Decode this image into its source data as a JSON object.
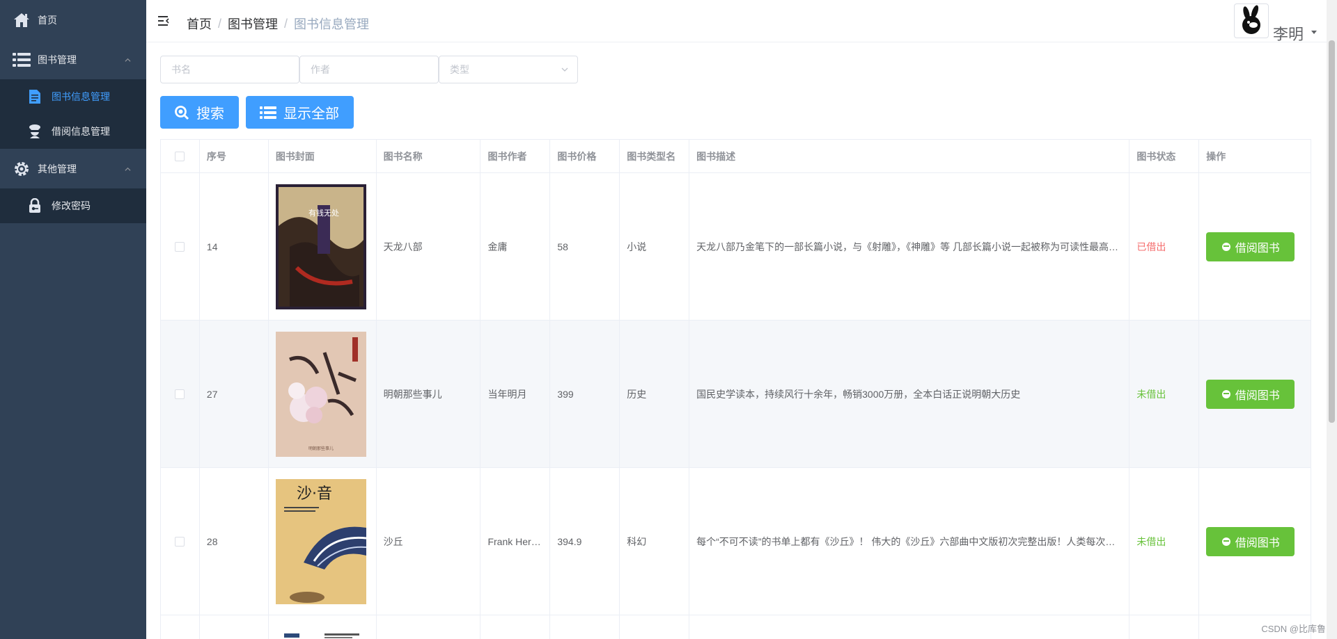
{
  "sidebar": {
    "items": [
      {
        "label": "首页",
        "icon": "home-icon"
      },
      {
        "label": "图书管理",
        "icon": "list-icon",
        "children": [
          {
            "label": "图书信息管理",
            "icon": "document-icon",
            "active": true
          },
          {
            "label": "借阅信息管理",
            "icon": "librarian-icon"
          }
        ]
      },
      {
        "label": "其他管理",
        "icon": "gear-icon",
        "children": [
          {
            "label": "修改密码",
            "icon": "lock-icon"
          }
        ]
      }
    ]
  },
  "header": {
    "breadcrumb": [
      "首页",
      "图书管理",
      "图书信息管理"
    ],
    "separator": "/",
    "username": "李明"
  },
  "filters": {
    "book_name_placeholder": "书名",
    "author_placeholder": "作者",
    "type_placeholder": "类型"
  },
  "buttons": {
    "search": "搜索",
    "show_all": "显示全部"
  },
  "table": {
    "headers": [
      "序号",
      "图书封面",
      "图书名称",
      "图书作者",
      "图书价格",
      "图书类型名",
      "图书描述",
      "图书状态",
      "操作"
    ],
    "rows": [
      {
        "id": "14",
        "name": "天龙八部",
        "author": "金庸",
        "price": "58",
        "type": "小说",
        "desc": "天龙八部乃金笔下的一部长篇小说，与《射雕》，《神雕》等 几部长篇小说一起被称为可读性最高的金庸小说",
        "status": "已借出",
        "status_kind": "out",
        "action": "借阅图书"
      },
      {
        "id": "27",
        "name": "明朝那些事儿",
        "author": "当年明月",
        "price": "399",
        "type": "历史",
        "desc": "国民史学读本，持续风行十余年，畅销3000万册，全本白话正说明朝大历史",
        "status": "未借出",
        "status_kind": "in",
        "action": "借阅图书"
      },
      {
        "id": "28",
        "name": "沙丘",
        "author": "Frank Herbert",
        "price": "394.9",
        "type": "科幻",
        "desc": "每个“不可不读”的书单上都有《沙丘》！ 伟大的《沙丘》六部曲中文版初次完整出版！人类每次的征途",
        "status": "未借出",
        "status_kind": "in",
        "action": "借阅图书"
      }
    ]
  },
  "covers": {
    "cover1_text": "有钱无处",
    "cover2_text": "明朝那些事儿",
    "cover3_text": "沙·音"
  },
  "colors": {
    "sidebar_bg": "#304156",
    "submenu_bg": "#1f2d3d",
    "primary": "#409eff",
    "success": "#67c23a",
    "danger": "#f56c6c"
  },
  "watermark": "CSDN @比库鲁"
}
